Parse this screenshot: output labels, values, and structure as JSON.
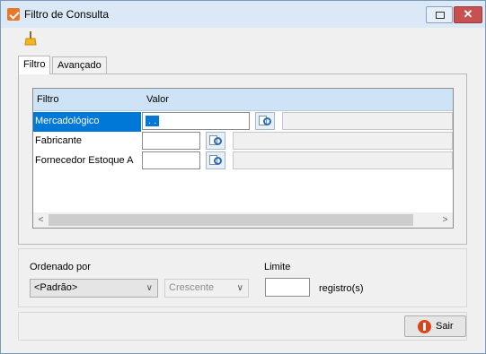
{
  "window": {
    "title": "Filtro de Consulta",
    "close_glyph": "✕"
  },
  "tabs": [
    {
      "label": "Filtro",
      "active": true
    },
    {
      "label": "Avançado",
      "active": false
    }
  ],
  "grid": {
    "columns": [
      "Filtro",
      "Valor"
    ],
    "rows": [
      {
        "label": "Mercadológico",
        "value": " .  .",
        "selected": true
      },
      {
        "label": "Fabricante",
        "value": "",
        "selected": false
      },
      {
        "label": "Fornecedor Estoque A",
        "value": "",
        "selected": false
      }
    ],
    "scroll_left": "<",
    "scroll_right": ">"
  },
  "order": {
    "label": "Ordenado por",
    "selected": "<Padrão>",
    "direction": "Crescente",
    "caret": "∨"
  },
  "limit": {
    "label": "Limite",
    "value": "",
    "unit": "registro(s)"
  },
  "footer": {
    "exit_label": "Sair"
  },
  "colors": {
    "selection": "#0078d7",
    "header": "#cfe3f6",
    "close": "#c75050"
  }
}
